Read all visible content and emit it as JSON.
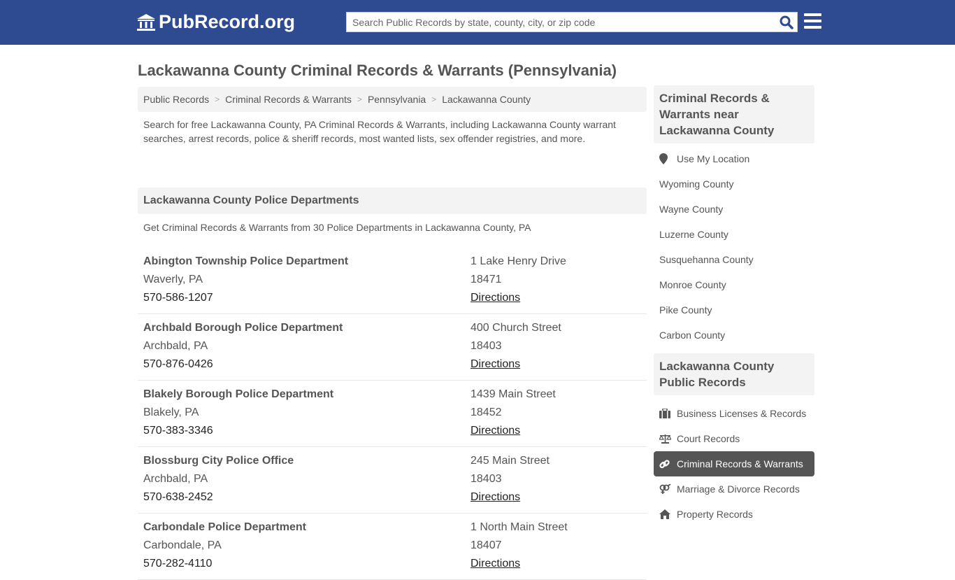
{
  "header": {
    "logo": "PubRecord.org",
    "search_placeholder": "Search Public Records by state, county, city, or zip code"
  },
  "page_title": "Lackawanna County Criminal Records & Warrants (Pennsylvania)",
  "breadcrumb": [
    "Public Records",
    "Criminal Records & Warrants",
    "Pennsylvania",
    "Lackawanna County"
  ],
  "intro": "Search for free Lackawanna County, PA Criminal Records & Warrants, including Lackawanna County warrant searches, arrest records, police & sheriff records, most wanted lists, sex offender registries, and more.",
  "section": {
    "title": "Lackawanna County Police Departments",
    "subtitle": "Get Criminal Records & Warrants from 30 Police Departments in Lackawanna County, PA"
  },
  "departments": [
    {
      "name": "Abington Township Police Department",
      "city": "Waverly, PA",
      "phone": "570-586-1207",
      "street": "1 Lake Henry Drive",
      "zip": "18471",
      "link": "Directions"
    },
    {
      "name": "Archbald Borough Police Department",
      "city": "Archbald, PA",
      "phone": "570-876-0426",
      "street": "400 Church Street",
      "zip": "18403",
      "link": "Directions"
    },
    {
      "name": "Blakely Borough Police Department",
      "city": "Blakely, PA",
      "phone": "570-383-3346",
      "street": "1439 Main Street",
      "zip": "18452",
      "link": "Directions"
    },
    {
      "name": "Blossburg City Police Office",
      "city": "Archbald, PA",
      "phone": "570-638-2452",
      "street": "245 Main Street",
      "zip": "18403",
      "link": "Directions"
    },
    {
      "name": "Carbondale Police Department",
      "city": "Carbondale, PA",
      "phone": "570-282-4110",
      "street": "1 North Main Street",
      "zip": "18407",
      "link": "Directions"
    }
  ],
  "sidebar": {
    "near_title": "Criminal Records & Warrants near Lackawanna County",
    "near_items": [
      "Use My Location",
      "Wyoming County",
      "Wayne County",
      "Luzerne County",
      "Susquehanna County",
      "Monroe County",
      "Pike County",
      "Carbon County"
    ],
    "records_title": "Lackawanna County Public Records",
    "records_items": [
      {
        "label": "Business Licenses & Records",
        "icon": "briefcase-icon"
      },
      {
        "label": "Court Records",
        "icon": "scales-icon"
      },
      {
        "label": "Criminal Records & Warrants",
        "icon": "link-icon",
        "active": true
      },
      {
        "label": "Marriage & Divorce Records",
        "icon": "gender-icon"
      },
      {
        "label": "Property Records",
        "icon": "home-icon"
      }
    ]
  },
  "colors": {
    "brand": "#2e4a91",
    "active": "#555555"
  }
}
